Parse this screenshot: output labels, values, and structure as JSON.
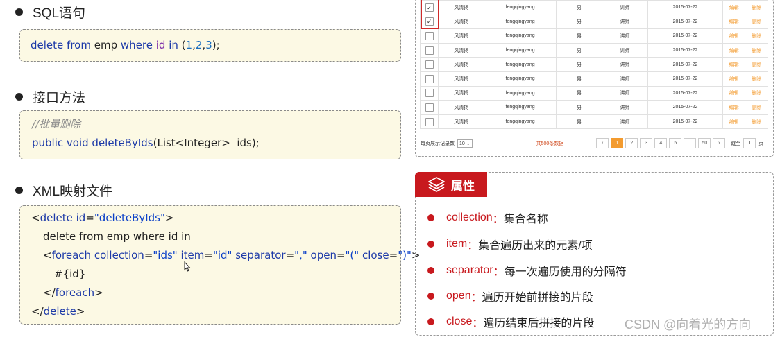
{
  "sections": {
    "sql": {
      "title": "SQL语句",
      "code": {
        "t1": "delete",
        "t2": " ",
        "t3": "from",
        "t4": " emp ",
        "t5": "where",
        "t6": " ",
        "t7": "id",
        "t8": " ",
        "t9": "in",
        "t10": " (",
        "t11": "1",
        "t12": ",",
        "t13": "2",
        "t14": ",",
        "t15": "3",
        "t16": ");"
      }
    },
    "interface": {
      "title": "接口方法",
      "comment": "//批量删除",
      "sig": {
        "a": "public void ",
        "b": "deleteByIds",
        "c": "(List<Integer>  ids);"
      }
    },
    "xml": {
      "title": "XML映射文件",
      "lines": {
        "l1a": "<",
        "l1b": "delete",
        "l1c": " ",
        "l1d": "id",
        "l1e": "=",
        "l1f": "\"deleteByIds\"",
        "l1g": ">",
        "l2": "delete from emp where id in",
        "l3a": "<",
        "l3b": "foreach",
        "l3c": " ",
        "l3d": "collection",
        "l3e": "=",
        "l3f": "\"ids\"",
        "l3g": " ",
        "l3h": "item",
        "l3i": "=",
        "l3j": "\"id\"",
        "l3k": " ",
        "l3l": "separator",
        "l3m": "=",
        "l3n": "\",\"",
        "l3o": " ",
        "l3p": "open",
        "l3q": "=",
        "l3r": "\"(\"",
        "l3s": " ",
        "l3t": "close",
        "l3u": "=",
        "l3v": "\")\"",
        "l3w": ">",
        "l4": "#{id}",
        "l5a": "</",
        "l5b": "foreach",
        "l5c": ">",
        "l6a": "</",
        "l6b": "delete",
        "l6c": ">"
      }
    }
  },
  "table": {
    "rows": [
      {
        "checked": true,
        "name": "风清扬",
        "user": "fengqingyang",
        "gender": "男",
        "role": "讲师",
        "date": "2015-07-22",
        "edit": "编辑",
        "del": "删除"
      },
      {
        "checked": true,
        "name": "风清扬",
        "user": "fengqingyang",
        "gender": "男",
        "role": "讲师",
        "date": "2015-07-22",
        "edit": "编辑",
        "del": "删除"
      },
      {
        "checked": false,
        "name": "风清扬",
        "user": "fengqingyang",
        "gender": "男",
        "role": "讲师",
        "date": "2015-07-22",
        "edit": "编辑",
        "del": "删除"
      },
      {
        "checked": false,
        "name": "风清扬",
        "user": "fengqingyang",
        "gender": "男",
        "role": "讲师",
        "date": "2015-07-22",
        "edit": "编辑",
        "del": "删除"
      },
      {
        "checked": false,
        "name": "风清扬",
        "user": "fengqingyang",
        "gender": "男",
        "role": "讲师",
        "date": "2015-07-22",
        "edit": "编辑",
        "del": "删除"
      },
      {
        "checked": false,
        "name": "风清扬",
        "user": "fengqingyang",
        "gender": "男",
        "role": "讲师",
        "date": "2015-07-22",
        "edit": "编辑",
        "del": "删除"
      },
      {
        "checked": false,
        "name": "风清扬",
        "user": "fengqingyang",
        "gender": "男",
        "role": "讲师",
        "date": "2015-07-22",
        "edit": "编辑",
        "del": "删除"
      },
      {
        "checked": false,
        "name": "风清扬",
        "user": "fengqingyang",
        "gender": "男",
        "role": "讲师",
        "date": "2015-07-22",
        "edit": "编辑",
        "del": "删除"
      },
      {
        "checked": false,
        "name": "风清扬",
        "user": "fengqingyang",
        "gender": "男",
        "role": "讲师",
        "date": "2015-07-22",
        "edit": "编辑",
        "del": "删除"
      }
    ],
    "checkmark": "✓",
    "pager": {
      "per_page_label": "每页展示记录数",
      "per_page_value": "10",
      "total": "共500条数据",
      "prev": "‹",
      "pages": [
        "1",
        "2",
        "3",
        "4",
        "5",
        "...",
        "50"
      ],
      "next": "›",
      "goto_label": "跳至",
      "goto_value": "1",
      "page_suffix": "页"
    }
  },
  "attributes": {
    "header": "属性",
    "accent_color": "#c8191e",
    "items": [
      {
        "key": "collection",
        "sep": "：",
        "desc": "集合名称"
      },
      {
        "key": "item",
        "sep": "：",
        "desc": "集合遍历出来的元素/项"
      },
      {
        "key": "separator",
        "sep": "：",
        "desc": "每一次遍历使用的分隔符"
      },
      {
        "key": "open",
        "sep": "：",
        "desc": "遍历开始前拼接的片段"
      },
      {
        "key": "close",
        "sep": "：",
        "desc": "遍历结束后拼接的片段"
      }
    ]
  },
  "watermark": "CSDN @向着光的方向"
}
